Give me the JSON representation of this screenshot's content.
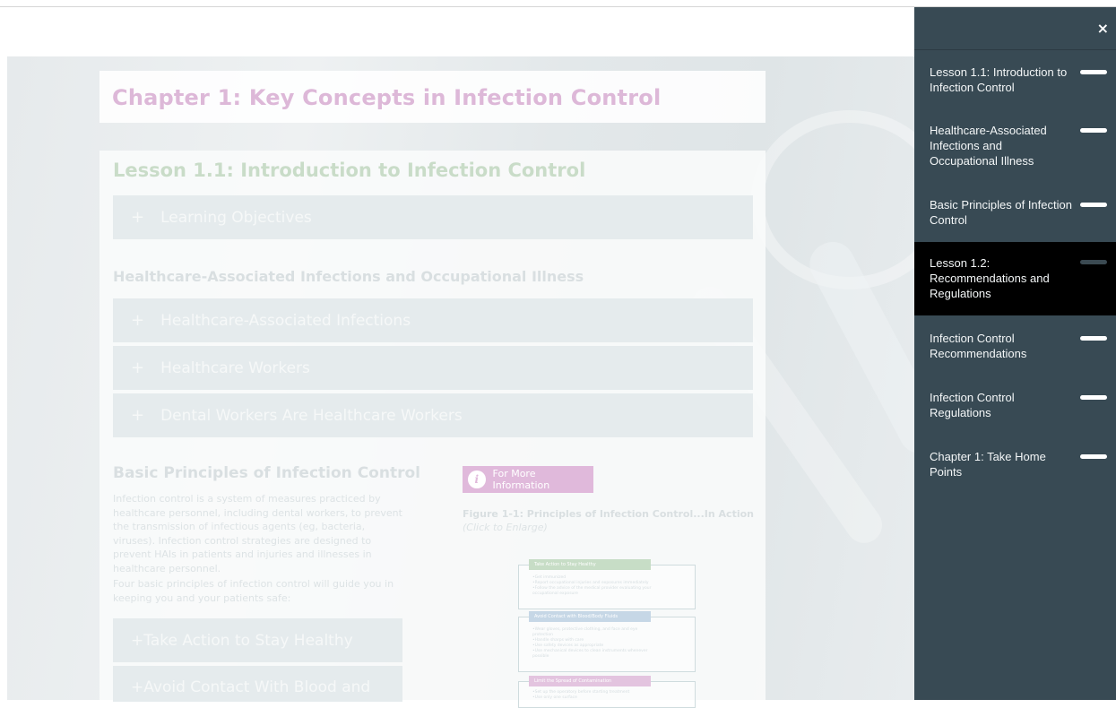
{
  "chapter_title": "Chapter 1: Key Concepts in Infection Control",
  "lesson_title": "Lesson 1.1: Introduction to Infection Control",
  "accordion_learning_objectives": "Learning Objectives",
  "section_hai_title": "Healthcare-Associated Infections and Occupational Illness",
  "hai_accordions": [
    "Healthcare-Associated Infections",
    "Healthcare Workers",
    "Dental Workers Are Healthcare Workers"
  ],
  "basic_principles_title": "Basic Principles of Infection Control",
  "basic_para_1": "Infection control is a system of measures practiced by healthcare personnel, including dental workers, to prevent the transmission of infectious agents (eg, bacteria, viruses). Infection control strategies are designed to prevent HAIs in patients and injuries and illnesses in healthcare personnel.",
  "basic_para_2": "Four basic principles of infection control will guide you in keeping you and your patients safe:",
  "principle_accordions": [
    "Take Action to Stay Healthy",
    "Avoid Contact With Blood and"
  ],
  "info_button_label": "For More Information",
  "figure_title": "Figure 1-1: Principles of Infection Control...In Action",
  "figure_subtitle": "(Click to Enlarge)",
  "figure": {
    "box1_head": "Take Action to Stay Healthy",
    "box1_lines": [
      "•Get immunized",
      "•Report occupational injuries and exposures immediately",
      "•Follow the advice of the medical provider evaluating your",
      "  occupational exposure"
    ],
    "box2_head": "Avoid Contact with Blood/Body Fluids",
    "box2_lines": [
      "•Wear gloves, protective clothing, and face and eye",
      "  protection",
      "•Handle sharps with care",
      "•Use safety devices as appropriate",
      "•Use mechanical devices to clean instruments whenever",
      "  possible"
    ],
    "box3_head": "Limit the Spread of Contamination",
    "box3_lines": [
      "•Set up the operatory before starting treatment",
      "•Use only one surface"
    ]
  },
  "colors": {
    "sidebar_bg": "#384a54",
    "active_bg": "#000000",
    "chapter_title": "#ddb8d8",
    "lesson_title": "#c9dcc8",
    "box1": "#c7ddc6",
    "box2": "#c6d7e6",
    "box3": "#e3c4df"
  },
  "sidebar": {
    "close_label": "×",
    "items": [
      {
        "label": "Lesson 1.1: Introduction to Infection Control",
        "active": false
      },
      {
        "label": "Healthcare-Associated Infections and Occupational Illness",
        "active": false
      },
      {
        "label": "Basic Principles of Infection Control",
        "active": false
      },
      {
        "label": "Lesson 1.2: Recommendations and Regulations",
        "active": true
      },
      {
        "label": "Infection Control Recommendations",
        "active": false
      },
      {
        "label": "Infection Control Regulations",
        "active": false
      },
      {
        "label": "Chapter 1: Take Home Points",
        "active": false
      }
    ]
  }
}
